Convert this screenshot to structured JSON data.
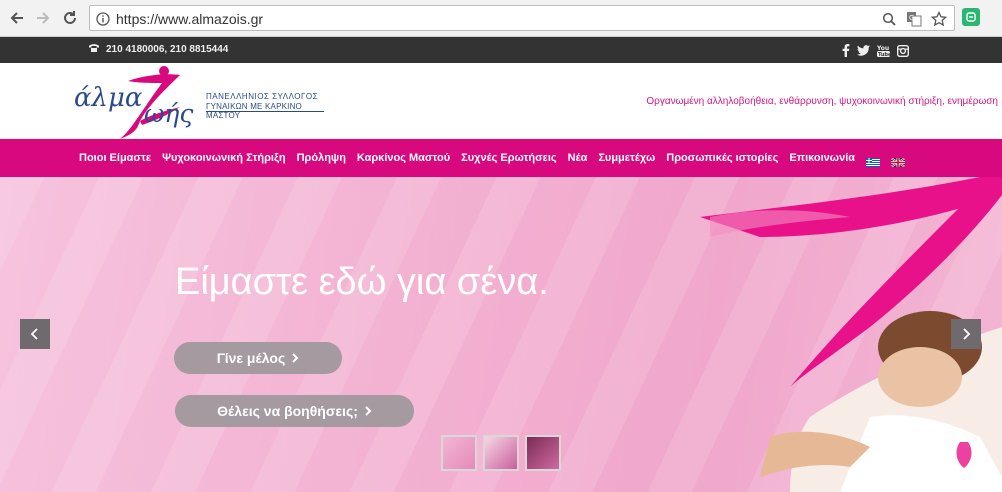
{
  "browser": {
    "url": "https://www.almazois.gr"
  },
  "topbar": {
    "phone": "210 4180006, 210 8815444",
    "social": [
      "facebook-icon",
      "twitter-icon",
      "youtube-icon",
      "instagram-icon"
    ]
  },
  "header": {
    "logo_line1": "άλμα",
    "logo_line2": "ωής",
    "logo_sub1": "ΠΑΝΕΛΛΗΝΙΟΣ ΣΥΛΛΟΓΟΣ",
    "logo_sub2": "ΓΥΝΑΙΚΩΝ ΜΕ ΚΑΡΚΙΝΟ ΜΑΣΤΟΥ",
    "tagline": "Οργανωμένη αλληλοβοήθεια, ενθάρρυνση, ψυχοκοινωνική στήριξη, ενημέρωση"
  },
  "menu": {
    "items": [
      {
        "label": "Ποιοι Είμαστε"
      },
      {
        "label": "Ψυχοκοινωνική Στήριξη"
      },
      {
        "label": "Πρόληψη"
      },
      {
        "label": "Καρκίνος Μαστού"
      },
      {
        "label": "Συχνές Ερωτήσεις"
      },
      {
        "label": "Νέα"
      },
      {
        "label": "Συμμετέχω"
      },
      {
        "label": "Προσωπικές ιστορίες"
      },
      {
        "label": "Επικοινωνία"
      }
    ]
  },
  "hero": {
    "title": "Είμαστε εδώ για σένα.",
    "button1": "Γίνε μέλος",
    "button2": "Θέλεις να βοηθήσεις;"
  },
  "colors": {
    "brand_pink": "#d8097e",
    "brand_blue": "#2b4a8b",
    "topbar": "#333333"
  }
}
